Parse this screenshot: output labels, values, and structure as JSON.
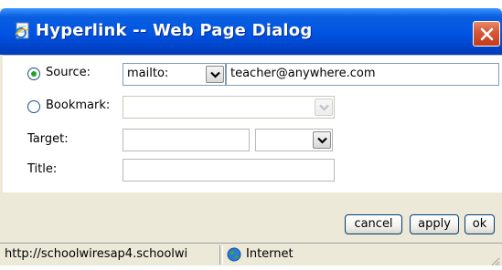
{
  "window": {
    "title": "Hyperlink -- Web Page Dialog"
  },
  "icons": {
    "title": "ie-page-icon",
    "close": "close-icon",
    "dropdown": "chevron-down-icon",
    "zone": "internet-globe-icon"
  },
  "form": {
    "source": {
      "label": "Source:",
      "checked": true,
      "protocol": "mailto:",
      "value": "teacher@anywhere.com"
    },
    "bookmark": {
      "label": "Bookmark:",
      "checked": false,
      "value": ""
    },
    "target": {
      "label": "Target:",
      "value": "",
      "select_value": ""
    },
    "title": {
      "label": "Title:",
      "value": ""
    }
  },
  "buttons": {
    "cancel": "cancel",
    "apply": "apply",
    "ok": "ok"
  },
  "status": {
    "url": "http://schoolwiresap4.schoolwi",
    "zone": "Internet"
  },
  "colors": {
    "titlebar": "#0054e3",
    "close_button": "#d9593a",
    "radio_dot": "#21a121",
    "field_border": "#7f9db9",
    "dialog_bg": "#ece9d8"
  }
}
